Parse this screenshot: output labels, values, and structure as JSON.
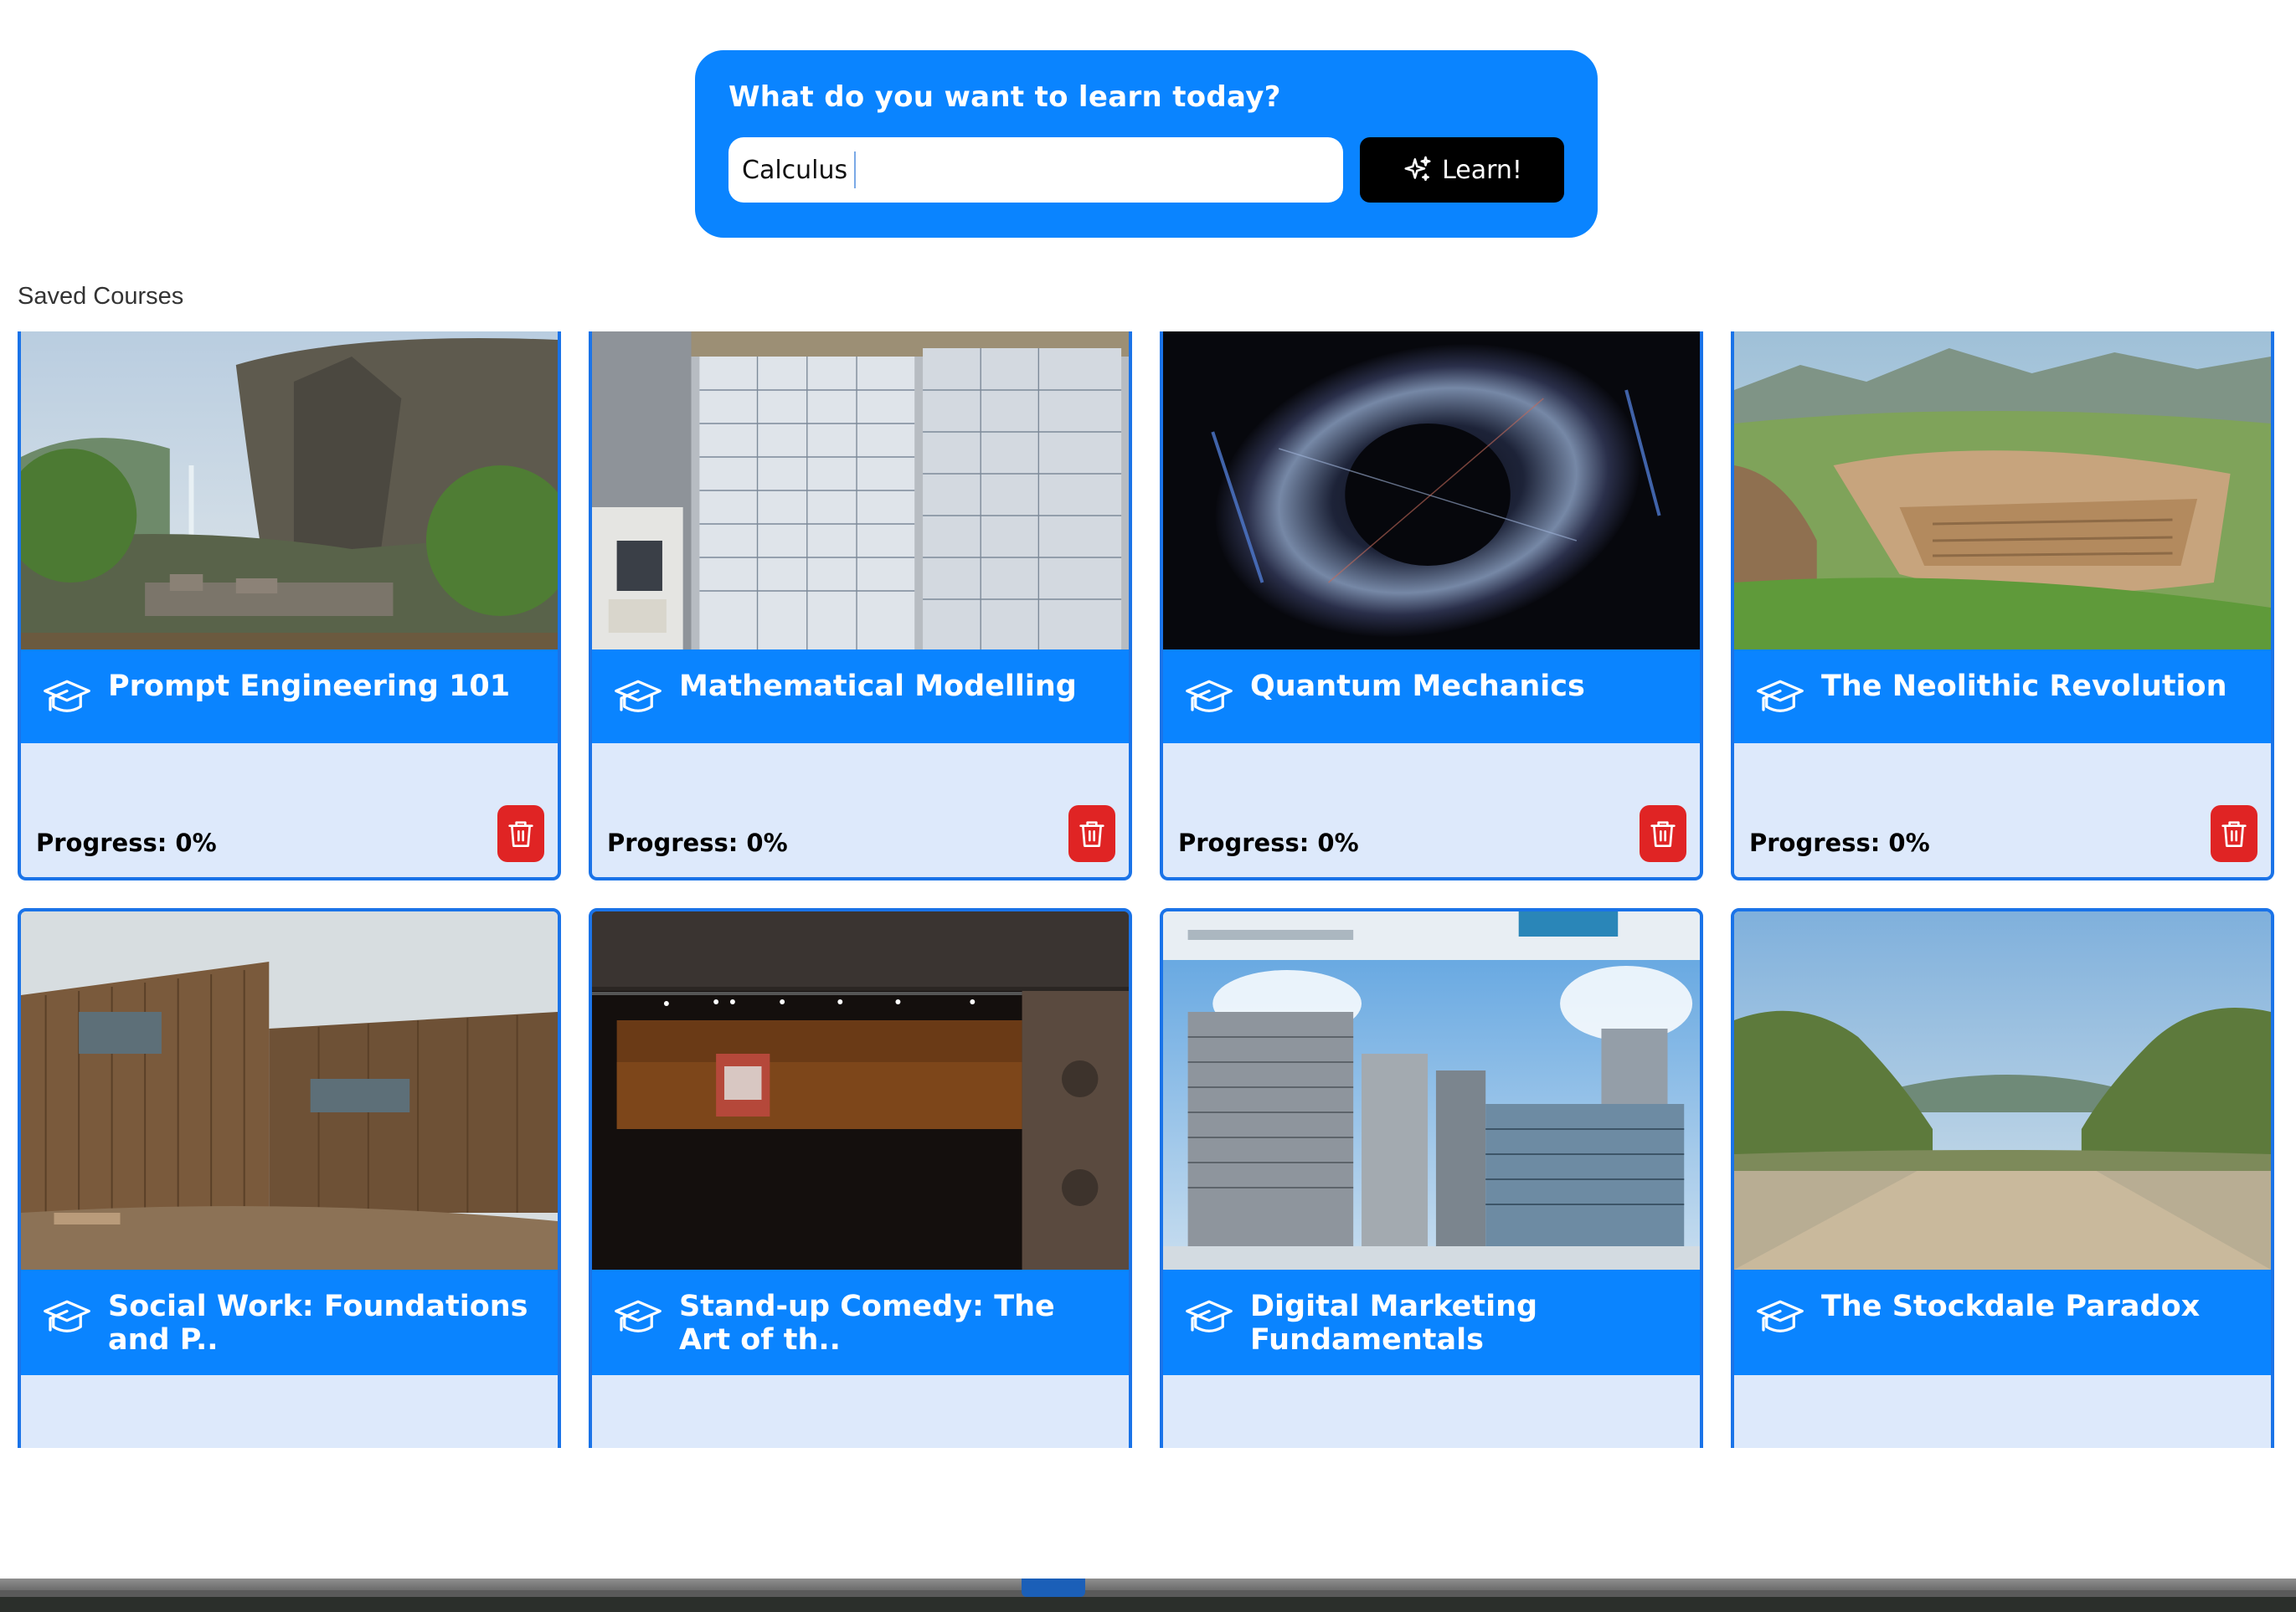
{
  "search": {
    "prompt": "What do you want to learn today?",
    "value": "Calculus",
    "button_label": "Learn!"
  },
  "saved": {
    "heading": "Saved Courses",
    "courses": [
      {
        "title": "Prompt Engineering 101",
        "progress": "Progress: 0%"
      },
      {
        "title": "Mathematical Modelling",
        "progress": "Progress: 0%"
      },
      {
        "title": "Quantum Mechanics",
        "progress": "Progress: 0%"
      },
      {
        "title": "The Neolithic Revolution",
        "progress": "Progress: 0%"
      },
      {
        "title": "Social Work: Foundations and P..",
        "progress": ""
      },
      {
        "title": "Stand-up Comedy: The Art of th..",
        "progress": ""
      },
      {
        "title": "Digital Marketing Fundamentals",
        "progress": ""
      },
      {
        "title": "The Stockdale Paradox",
        "progress": ""
      }
    ]
  },
  "colors": {
    "accent": "#0a84ff",
    "card_body": "#dde9fb",
    "delete": "#e02424",
    "button": "#000000"
  },
  "icons": {
    "course": "graduation-cap-icon",
    "delete": "trash-icon",
    "learn": "sparkles-icon"
  }
}
